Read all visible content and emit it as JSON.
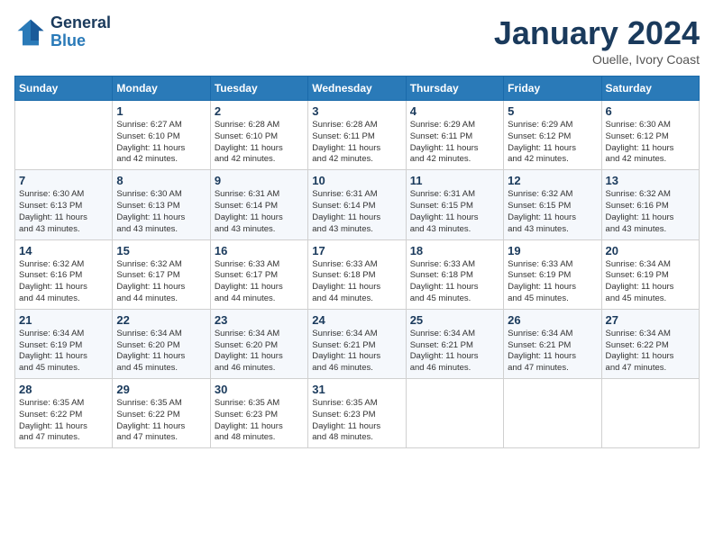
{
  "header": {
    "logo_line1": "General",
    "logo_line2": "Blue",
    "month": "January 2024",
    "location": "Ouelle, Ivory Coast"
  },
  "days_of_week": [
    "Sunday",
    "Monday",
    "Tuesday",
    "Wednesday",
    "Thursday",
    "Friday",
    "Saturday"
  ],
  "weeks": [
    [
      {
        "day": "",
        "info": ""
      },
      {
        "day": "1",
        "info": "Sunrise: 6:27 AM\nSunset: 6:10 PM\nDaylight: 11 hours\nand 42 minutes."
      },
      {
        "day": "2",
        "info": "Sunrise: 6:28 AM\nSunset: 6:10 PM\nDaylight: 11 hours\nand 42 minutes."
      },
      {
        "day": "3",
        "info": "Sunrise: 6:28 AM\nSunset: 6:11 PM\nDaylight: 11 hours\nand 42 minutes."
      },
      {
        "day": "4",
        "info": "Sunrise: 6:29 AM\nSunset: 6:11 PM\nDaylight: 11 hours\nand 42 minutes."
      },
      {
        "day": "5",
        "info": "Sunrise: 6:29 AM\nSunset: 6:12 PM\nDaylight: 11 hours\nand 42 minutes."
      },
      {
        "day": "6",
        "info": "Sunrise: 6:30 AM\nSunset: 6:12 PM\nDaylight: 11 hours\nand 42 minutes."
      }
    ],
    [
      {
        "day": "7",
        "info": "Sunrise: 6:30 AM\nSunset: 6:13 PM\nDaylight: 11 hours\nand 43 minutes."
      },
      {
        "day": "8",
        "info": "Sunrise: 6:30 AM\nSunset: 6:13 PM\nDaylight: 11 hours\nand 43 minutes."
      },
      {
        "day": "9",
        "info": "Sunrise: 6:31 AM\nSunset: 6:14 PM\nDaylight: 11 hours\nand 43 minutes."
      },
      {
        "day": "10",
        "info": "Sunrise: 6:31 AM\nSunset: 6:14 PM\nDaylight: 11 hours\nand 43 minutes."
      },
      {
        "day": "11",
        "info": "Sunrise: 6:31 AM\nSunset: 6:15 PM\nDaylight: 11 hours\nand 43 minutes."
      },
      {
        "day": "12",
        "info": "Sunrise: 6:32 AM\nSunset: 6:15 PM\nDaylight: 11 hours\nand 43 minutes."
      },
      {
        "day": "13",
        "info": "Sunrise: 6:32 AM\nSunset: 6:16 PM\nDaylight: 11 hours\nand 43 minutes."
      }
    ],
    [
      {
        "day": "14",
        "info": "Sunrise: 6:32 AM\nSunset: 6:16 PM\nDaylight: 11 hours\nand 44 minutes."
      },
      {
        "day": "15",
        "info": "Sunrise: 6:32 AM\nSunset: 6:17 PM\nDaylight: 11 hours\nand 44 minutes."
      },
      {
        "day": "16",
        "info": "Sunrise: 6:33 AM\nSunset: 6:17 PM\nDaylight: 11 hours\nand 44 minutes."
      },
      {
        "day": "17",
        "info": "Sunrise: 6:33 AM\nSunset: 6:18 PM\nDaylight: 11 hours\nand 44 minutes."
      },
      {
        "day": "18",
        "info": "Sunrise: 6:33 AM\nSunset: 6:18 PM\nDaylight: 11 hours\nand 45 minutes."
      },
      {
        "day": "19",
        "info": "Sunrise: 6:33 AM\nSunset: 6:19 PM\nDaylight: 11 hours\nand 45 minutes."
      },
      {
        "day": "20",
        "info": "Sunrise: 6:34 AM\nSunset: 6:19 PM\nDaylight: 11 hours\nand 45 minutes."
      }
    ],
    [
      {
        "day": "21",
        "info": "Sunrise: 6:34 AM\nSunset: 6:19 PM\nDaylight: 11 hours\nand 45 minutes."
      },
      {
        "day": "22",
        "info": "Sunrise: 6:34 AM\nSunset: 6:20 PM\nDaylight: 11 hours\nand 45 minutes."
      },
      {
        "day": "23",
        "info": "Sunrise: 6:34 AM\nSunset: 6:20 PM\nDaylight: 11 hours\nand 46 minutes."
      },
      {
        "day": "24",
        "info": "Sunrise: 6:34 AM\nSunset: 6:21 PM\nDaylight: 11 hours\nand 46 minutes."
      },
      {
        "day": "25",
        "info": "Sunrise: 6:34 AM\nSunset: 6:21 PM\nDaylight: 11 hours\nand 46 minutes."
      },
      {
        "day": "26",
        "info": "Sunrise: 6:34 AM\nSunset: 6:21 PM\nDaylight: 11 hours\nand 47 minutes."
      },
      {
        "day": "27",
        "info": "Sunrise: 6:34 AM\nSunset: 6:22 PM\nDaylight: 11 hours\nand 47 minutes."
      }
    ],
    [
      {
        "day": "28",
        "info": "Sunrise: 6:35 AM\nSunset: 6:22 PM\nDaylight: 11 hours\nand 47 minutes."
      },
      {
        "day": "29",
        "info": "Sunrise: 6:35 AM\nSunset: 6:22 PM\nDaylight: 11 hours\nand 47 minutes."
      },
      {
        "day": "30",
        "info": "Sunrise: 6:35 AM\nSunset: 6:23 PM\nDaylight: 11 hours\nand 48 minutes."
      },
      {
        "day": "31",
        "info": "Sunrise: 6:35 AM\nSunset: 6:23 PM\nDaylight: 11 hours\nand 48 minutes."
      },
      {
        "day": "",
        "info": ""
      },
      {
        "day": "",
        "info": ""
      },
      {
        "day": "",
        "info": ""
      }
    ]
  ]
}
